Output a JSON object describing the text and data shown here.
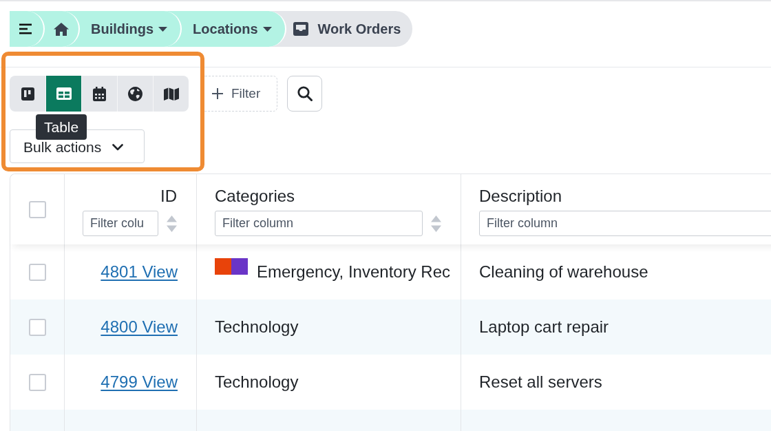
{
  "breadcrumb": [
    {
      "kind": "menu",
      "current": false
    },
    {
      "kind": "home",
      "current": false
    },
    {
      "kind": "dropdown",
      "label": "Buildings",
      "current": false
    },
    {
      "kind": "dropdown",
      "label": "Locations",
      "current": false
    },
    {
      "kind": "page",
      "label": "Work Orders",
      "current": true
    }
  ],
  "toolbar": {
    "views": [
      {
        "kind": "board",
        "selected": false
      },
      {
        "kind": "table",
        "selected": true
      },
      {
        "kind": "calendar",
        "selected": false
      },
      {
        "kind": "globe",
        "selected": false
      },
      {
        "kind": "map",
        "selected": false
      }
    ],
    "filter_button": {
      "label": "Filter"
    },
    "tooltip": {
      "text": "Table"
    },
    "bulk_actions": {
      "label": "Bulk actions"
    }
  },
  "table": {
    "select_all": {
      "checked": false
    },
    "columns": [
      {
        "kind": "id",
        "label": "ID",
        "placeholder": "Filter colu"
      },
      {
        "kind": "text",
        "label": "Categories",
        "placeholder": "Filter column"
      },
      {
        "kind": "text",
        "label": "Description",
        "placeholder": "Filter column"
      }
    ],
    "rows": [
      {
        "checked": false,
        "id": "4801 View",
        "swatches": [
          {
            "color": "#e8430a"
          },
          {
            "color": "#6a35c7"
          }
        ],
        "categories": "Emergency, Inventory Rec",
        "description": "Cleaning of warehouse"
      },
      {
        "checked": false,
        "id": "4800 View",
        "swatches": [],
        "categories": "Technology",
        "description": "Laptop cart repair"
      },
      {
        "checked": false,
        "id": "4799 View",
        "swatches": [],
        "categories": "Technology",
        "description": "Reset all servers"
      }
    ]
  }
}
